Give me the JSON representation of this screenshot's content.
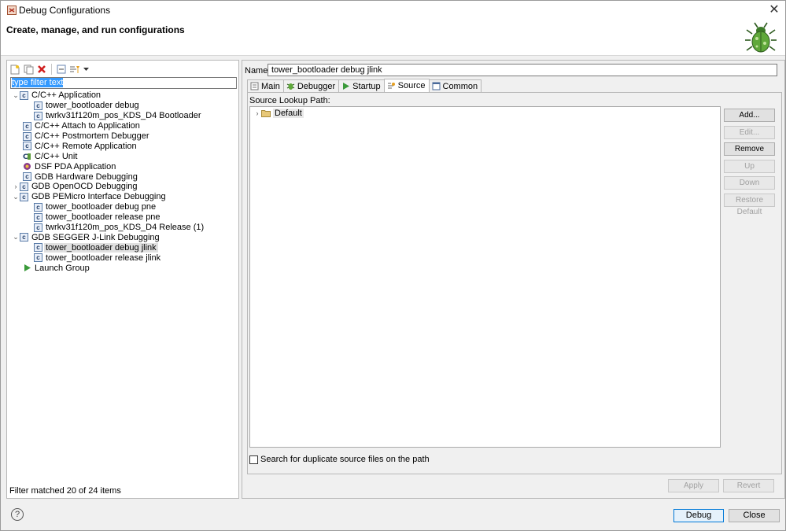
{
  "window": {
    "title": "Debug Configurations",
    "close_glyph": "✕"
  },
  "header": {
    "title": "Create, manage, and run configurations"
  },
  "left": {
    "filter_placeholder": "type filter text",
    "status": "Filter matched 20 of 24 items",
    "tree": [
      {
        "label": "C/C++ Application",
        "expander": "⌄",
        "icon": "c-icon"
      },
      {
        "label": "tower_bootloader debug",
        "icon": "c-icon"
      },
      {
        "label": "twrkv31f120m_pos_KDS_D4 Bootloader",
        "icon": "c-icon"
      },
      {
        "label": "C/C++ Attach to Application",
        "icon": "c-icon"
      },
      {
        "label": "C/C++ Postmortem Debugger",
        "icon": "c-icon"
      },
      {
        "label": "C/C++ Remote Application",
        "icon": "c-icon"
      },
      {
        "label": "C/C++ Unit",
        "icon": "cunit-icon"
      },
      {
        "label": "DSF PDA Application",
        "icon": "pda-icon"
      },
      {
        "label": "GDB Hardware Debugging",
        "icon": "c-icon"
      },
      {
        "label": "GDB OpenOCD Debugging",
        "expander": "›",
        "icon": "c-icon"
      },
      {
        "label": "GDB PEMicro Interface Debugging",
        "expander": "⌄",
        "icon": "c-icon"
      },
      {
        "label": "tower_bootloader debug pne",
        "icon": "c-icon"
      },
      {
        "label": "tower_bootloader release pne",
        "icon": "c-icon"
      },
      {
        "label": "twrkv31f120m_pos_KDS_D4 Release (1)",
        "icon": "c-icon"
      },
      {
        "label": "GDB SEGGER J-Link Debugging",
        "expander": "⌄",
        "icon": "c-icon"
      },
      {
        "label": "tower_bootloader debug jlink",
        "icon": "c-icon",
        "selected": true
      },
      {
        "label": "tower_bootloader release jlink",
        "icon": "c-icon"
      },
      {
        "label": "Launch Group",
        "icon": "launch-icon"
      }
    ]
  },
  "right": {
    "name_label": "Name:",
    "name_value": "tower_bootloader debug jlink",
    "tabs": [
      {
        "label": "Main"
      },
      {
        "label": "Debugger"
      },
      {
        "label": "Startup"
      },
      {
        "label": "Source",
        "active": true
      },
      {
        "label": "Common"
      }
    ],
    "source_label": "Source Lookup Path:",
    "source_items": [
      {
        "label": "Default",
        "expander": "›"
      }
    ],
    "buttons": [
      {
        "label": "Add...",
        "enabled": true
      },
      {
        "label": "Edit...",
        "enabled": false
      },
      {
        "label": "Remove",
        "enabled": true
      },
      {
        "label": "Up",
        "enabled": false
      },
      {
        "label": "Down",
        "enabled": false
      },
      {
        "label": "Restore Default",
        "enabled": false
      }
    ],
    "checkbox_label": "Search for duplicate source files on the path",
    "apply": "Apply",
    "revert": "Revert"
  },
  "footer": {
    "help": "?",
    "debug": "Debug",
    "close": "Close"
  }
}
